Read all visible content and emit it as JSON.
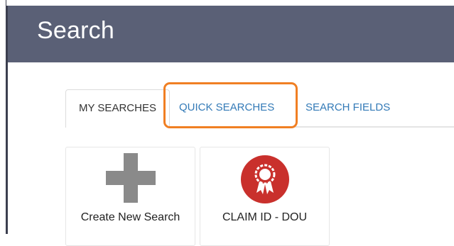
{
  "header": {
    "title": "Search"
  },
  "tabs": [
    {
      "label": "MY SEARCHES",
      "active": true
    },
    {
      "label": "QUICK SEARCHES",
      "active": false
    },
    {
      "label": "SEARCH FIELDS",
      "active": false
    }
  ],
  "cards": [
    {
      "label": "Create New Search",
      "icon": "plus-icon"
    },
    {
      "label": "CLAIM ID - DOU",
      "icon": "award-ribbon-icon"
    }
  ],
  "colors": {
    "header_bg": "#5a6076",
    "tab_link": "#337ab7",
    "highlight": "#f07f23",
    "plus": "#8a8a8a",
    "award": "#c9302c"
  }
}
